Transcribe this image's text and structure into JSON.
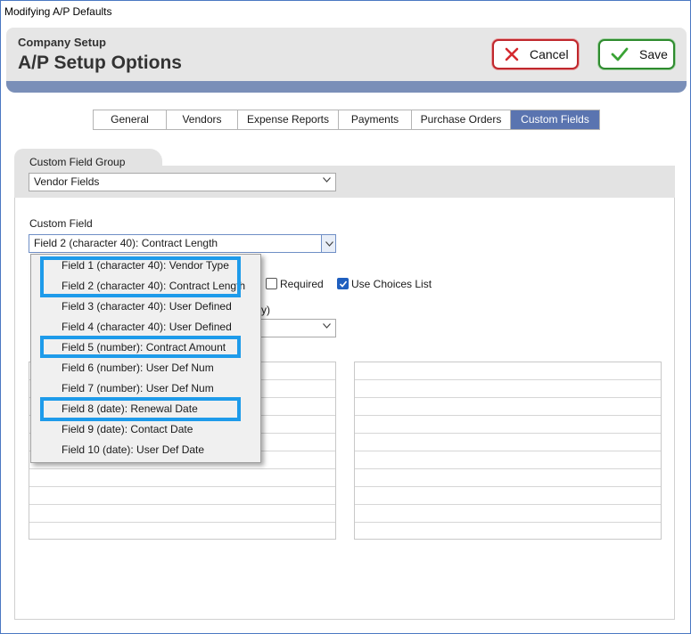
{
  "window": {
    "title": "Modifying A/P Defaults"
  },
  "header": {
    "subtitle": "Company Setup",
    "title": "A/P Setup Options"
  },
  "buttons": {
    "cancel": "Cancel",
    "save": "Save"
  },
  "tabs": [
    {
      "label": "General",
      "active": false
    },
    {
      "label": "Vendors",
      "active": false
    },
    {
      "label": "Expense Reports",
      "active": false
    },
    {
      "label": "Payments",
      "active": false
    },
    {
      "label": "Purchase Orders",
      "active": false
    },
    {
      "label": "Custom Fields",
      "active": true
    }
  ],
  "custom_field_group": {
    "label": "Custom Field Group",
    "value": "Vendor Fields"
  },
  "custom_field": {
    "label": "Custom Field",
    "value": "Field 2 (character 40): Contract Length"
  },
  "options": {
    "required_label": "Required",
    "required_checked": false,
    "use_choices_label": "Use Choices List",
    "use_choices_checked": true
  },
  "partial": {
    "paren": "y)"
  },
  "dropdown": {
    "items": [
      "Field 1 (character 40): Vendor Type",
      "Field 2 (character 40): Contract Length",
      "Field 3 (character 40): User Defined",
      "Field 4 (character 40): User Defined",
      "Field 5 (number): Contract Amount",
      "Field 6 (number): User Def Num",
      "Field 7 (number): User Def Num",
      "Field 8 (date): Renewal Date",
      "Field 9 (date): Contact Date",
      "Field 10 (date): User Def Date"
    ]
  },
  "colors": {
    "accent": "#5a74b0",
    "highlight": "#1e9bea",
    "cancel": "#c0282d",
    "save": "#2e8b2e"
  }
}
